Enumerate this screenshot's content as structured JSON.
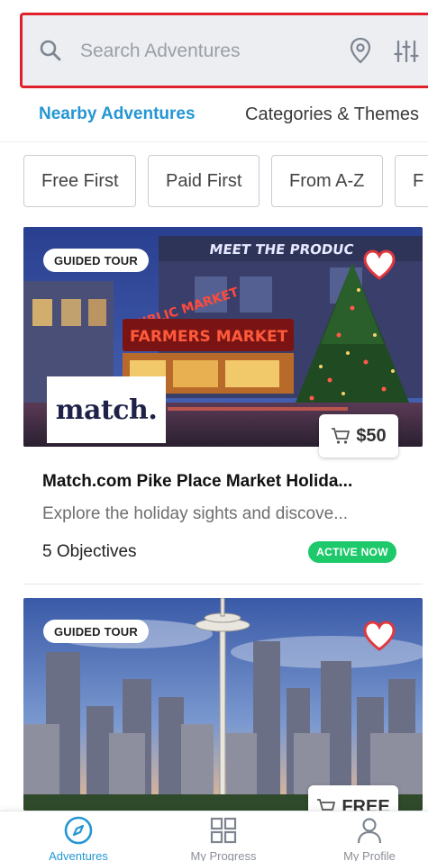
{
  "search": {
    "placeholder": "Search Adventures"
  },
  "tabs": [
    {
      "label": "Nearby Adventures",
      "active": true
    },
    {
      "label": "Categories & Themes",
      "active": false
    }
  ],
  "sort_chips": [
    "Free First",
    "Paid First",
    "From A-Z",
    "F"
  ],
  "cards": [
    {
      "badge": "GUIDED TOUR",
      "brand_logo": "match.",
      "price": "$50",
      "title": "Match.com Pike Place Market Holida...",
      "description": "Explore the holiday sights and discove...",
      "objectives": "5 Objectives",
      "status": "ACTIVE NOW",
      "sign_text": "FARMERS MARKET",
      "sign_text_top": "MEET THE PRODUC",
      "sign_public": "PUBLIC MARKET"
    },
    {
      "badge": "GUIDED TOUR",
      "price": "FREE"
    }
  ],
  "bottom_nav": [
    {
      "label": "Adventures",
      "icon": "compass-icon",
      "active": true
    },
    {
      "label": "My Progress",
      "icon": "grid-icon",
      "active": false
    },
    {
      "label": "My Profile",
      "icon": "person-icon",
      "active": false
    }
  ],
  "colors": {
    "accent": "#2596d4",
    "highlight_border": "#e0202a",
    "active_green": "#1ec96b",
    "heart": "#e0383e"
  }
}
